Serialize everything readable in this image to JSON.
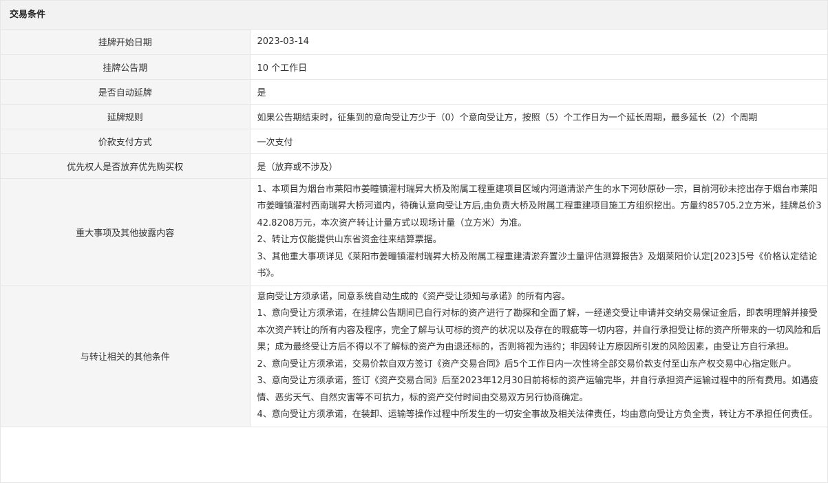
{
  "section": {
    "title": "交易条件"
  },
  "rows": [
    {
      "label": "挂牌开始日期",
      "value": "2023-03-14"
    },
    {
      "label": "挂牌公告期",
      "value": "10 个工作日"
    },
    {
      "label": "是否自动延牌",
      "value": "是"
    },
    {
      "label": "延牌规则",
      "value": "如果公告期结束时，征集到的意向受让方少于（0）个意向受让方，按照（5）个工作日为一个延长周期，最多延长（2）个周期"
    },
    {
      "label": "价款支付方式",
      "value": "一次支付"
    },
    {
      "label": "优先权人是否放弃优先购买权",
      "value": "是（放弃或不涉及）"
    },
    {
      "label": "重大事项及其他披露内容",
      "paragraphs": [
        "1、本项目为烟台市莱阳市姜疃镇濯村瑞昇大桥及附属工程重建项目区域内河道清淤产生的水下河砂原砂一宗，目前河砂未挖出存于烟台市莱阳市姜疃镇濯村西南瑞昇大桥河道内，待确认意向受让方后,由负责大桥及附属工程重建项目施工方组织挖出。方量约85705.2立方米，挂牌总价342.8208万元，本次资产转让计量方式以现场计量（立方米）为准。",
        "2、转让方仅能提供山东省资金往来结算票据。",
        "3、其他重大事项详见《莱阳市姜疃镇濯村瑞昇大桥及附属工程重建清淤弃置沙土量评估测算报告》及烟莱阳价认定[2023]5号《价格认定结论书》。"
      ]
    },
    {
      "label": "与转让相关的其他条件",
      "paragraphs": [
        "意向受让方须承诺，同意系统自动生成的《资产受让须知与承诺》的所有内容。",
        "1、意向受让方须承诺，在挂牌公告期间已自行对标的资产进行了勘探和全面了解，一经递交受让申请并交纳交易保证金后，即表明理解并接受本次资产转让的所有内容及程序，完全了解与认可标的资产的状况以及存在的瑕疵等一切内容，并自行承担受让标的资产所带来的一切风险和后果；成为最终受让方后不得以不了解标的资产为由退还标的，否则将视为违约；非因转让方原因所引发的风险因素，由受让方自行承担。",
        "2、意向受让方须承诺，交易价款自双方签订《资产交易合同》后5个工作日内一次性将全部交易价款支付至山东产权交易中心指定账户。",
        "3、意向受让方须承诺，签订《资产交易合同》后至2023年12月30日前将标的资产运输完毕，并自行承担资产运输过程中的所有费用。如遇疫情、恶劣天气、自然灾害等不可抗力，标的资产交付时间由交易双方另行协商确定。",
        "4、意向受让方须承诺，在装卸、运输等操作过程中所发生的一切安全事故及相关法律责任，均由意向受让方负全责，转让方不承担任何责任。"
      ]
    }
  ]
}
